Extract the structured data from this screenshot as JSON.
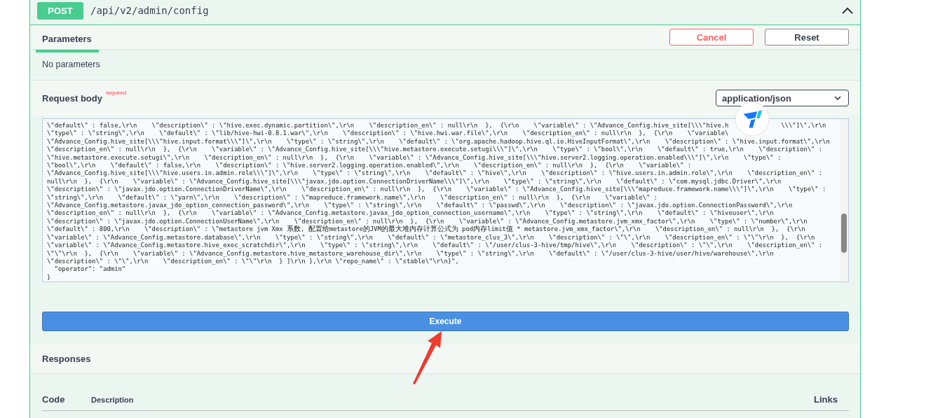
{
  "operation": {
    "method": "POST",
    "path": "/api/v2/admin/config",
    "expanded": true
  },
  "parameters_section": {
    "tab": "Parameters",
    "buttons": [
      {
        "label": "Cancel",
        "kind": "cancel"
      },
      {
        "label": "Reset",
        "kind": "reset"
      }
    ],
    "message": "No parameters"
  },
  "request_body": {
    "label": "Request body",
    "required_mark": "required",
    "content_type": "application/json",
    "lines": [
      "\\\"default\\\" : false,\\r\\n    \\\"description\\\" : \\\"hive.exec.dynamic.partition\\\",\\r\\n    \\\"description_en\\\" : null\\r\\n  },  {\\r\\n    \\\"variable\\\" : \\\"Advance_Config.hive_site[\\\\\\\"hive.h              \\\\\\\"]\\\",\\r\\n",
      "\\\"type\\\" : \\\"string\\\",\\r\\n    \\\"default\\\" : \\\"lib/hive-hwi-0.8.1.war\\\",\\r\\n    \\\"description\\\" : \\\"hive.hwi.war.file\\\",\\r\\n    \\\"description_en\\\" : null\\r\\n  },  {\\r\\n    \\\"variable\\",
      "\\\"Advance_Config.hive_site[\\\\\\\"hive.input.format\\\\\\\"]\\\",\\r\\n    \\\"type\\\" : \\\"string\\\",\\r\\n    \\\"default\\\" : \\\"org.apache.hadoop.hive.ql.io.HiveInputFormat\\\",\\r\\n    \\\"description\\\" : \\\"hive.input.format\\\",\\r\\n",
      "\\\"description_en\\\" : null\\r\\n  },  {\\r\\n    \\\"variable\\\" : \\\"Advance_Config.hive_site[\\\\\\\"hive.metastore.execute.setugi\\\\\\\"]\\\",\\r\\n    \\\"type\\\" : \\\"bool\\\",\\r\\n    \\\"default\\\" : true,\\r\\n    \\\"description\\\" :",
      "\\\"hive.metastore.execute.setugi\\\",\\r\\n    \\\"description_en\\\" : null\\r\\n  },  {\\r\\n    \\\"variable\\\" : \\\"Advance_Config.hive_site[\\\\\\\"hive.server2.logging.operation.enabled\\\\\\\"]\\\",\\r\\n    \\\"type\\\" :",
      "\\\"bool\\\",\\r\\n    \\\"default\\\" : false,\\r\\n    \\\"description\\\" : \\\"hive.server2.logging.operation.enabled\\\",\\r\\n    \\\"description_en\\\" : null\\r\\n  },  {\\r\\n    \\\"variable\\\" :",
      "\\\"Advance_Config.hive_site[\\\\\\\"hive.users.in.admin.role\\\\\\\"]\\\",\\r\\n    \\\"type\\\" : \\\"string\\\",\\r\\n    \\\"default\\\" : \\\"hive\\\",\\r\\n    \\\"description\\\" : \\\"hive.users.in.admin.role\\\",\\r\\n    \\\"description_en\\\" :",
      "null\\r\\n  },  {\\r\\n    \\\"variable\\\" : \\\"Advance_Config.hive_site[\\\\\\\"javax.jdo.option.ConnectionDriverName\\\\\\\"]\\\",\\r\\n    \\\"type\\\" : \\\"string\\\",\\r\\n    \\\"default\\\" : \\\"com.mysql.jdbc.Driver\\\",\\r\\n",
      "\\\"description\\\" : \\\"javax.jdo.option.ConnectionDriverName\\\",\\r\\n    \\\"description_en\\\" : null\\r\\n  },  {\\r\\n    \\\"variable\\\" : \\\"Advance_Config.hive_site[\\\\\\\"mapreduce.framework.name\\\\\\\"]\\\",\\r\\n    \\\"type\\\" :",
      "\\\"string\\\",\\r\\n    \\\"default\\\" : \\\"yarn\\\",\\r\\n    \\\"description\\\" : \\\"mapreduce.framework.name\\\",\\r\\n    \\\"description_en\\\" : null\\r\\n  },  {\\r\\n    \\\"variable\\\" :",
      "\\\"Advance_Config.metastore.javax_jdo_option_connection_password\\\",\\r\\n    \\\"type\\\" : \\\"string\\\",\\r\\n    \\\"default\\\" : \\\"passwd\\\",\\r\\n    \\\"description\\\" : \\\"javax.jdo.option.ConnectionPassword\\\",\\r\\n",
      "\\\"description_en\\\" : null\\r\\n  },  {\\r\\n    \\\"variable\\\" : \\\"Advance_Config.metastore.javax_jdo_option_connection_username\\\",\\r\\n    \\\"type\\\" : \\\"string\\\",\\r\\n    \\\"default\\\" : \\\"hiveuser\\\",\\r\\n",
      "\\\"description\\\" : \\\"javax.jdo.option.ConnectionUserName\\\",\\r\\n    \\\"description_en\\\" : null\\r\\n  },  {\\r\\n    \\\"variable\\\" : \\\"Advance_Config.metastore.jvm_xmx_factor\\\",\\r\\n    \\\"type\\\" : \\\"number\\\",\\r\\n",
      "\\\"default\\\" : 800,\\r\\n    \\\"description\\\" : \\\"metastore jvm Xmx 系数, 配置给metastore的JVM的最大堆内存计算公式为 pod内存limit值 * metastore.jvm_xmx_factor\\\",\\r\\n    \\\"description_en\\\" : null\\r\\n  },  {\\r\\n",
      "\\\"variable\\\" : \\\"Advance_Config.metastore.database\\\",\\r\\n    \\\"type\\\" : \\\"string\\\",\\r\\n    \\\"default\\\" : \\\"metastore_clus_3\\\",\\r\\n    \\\"description\\\" : \\\"\\\",\\r\\n    \\\"description_en\\\" : \\\"\\\"\\r\\n  },  {\\r\\n",
      "\\\"variable\\\" : \\\"Advance_Config.metastore.hive_exec_scratchdir\\\",\\r\\n    \\\"type\\\" : \\\"string\\\",\\r\\n    \\\"default\\\" : \\\"/user/clus-3-hive/tmp/hive\\\",\\r\\n    \\\"description\\\" : \\\"\\\",\\r\\n    \\\"description_en\\\" :",
      "\\\"\\\"\\r\\n  },  {\\r\\n    \\\"variable\\\" : \\\"Advance_Config.metastore.hive_metastore_warehouse_dir\\\",\\r\\n    \\\"type\\\" : \\\"string\\\",\\r\\n    \\\"default\\\" : \\\"/user/clus-3-hive/user/hive/warehouse\\\",\\r\\n",
      "\\\"description\\\" : \\\"\\\",\\r\\n    \\\"description_en\\\" : \\\"\\\"\\r\\n  } ]\\r\\n },\\r\\n \\\"repo_name\\\" : \\\"stable\\\"\\r\\n}\",",
      "  \"operator\": \"admin\"",
      "}"
    ]
  },
  "execute_button": "Execute",
  "responses": {
    "title": "Responses",
    "columns": [
      "Code",
      "Description",
      "Links"
    ]
  }
}
